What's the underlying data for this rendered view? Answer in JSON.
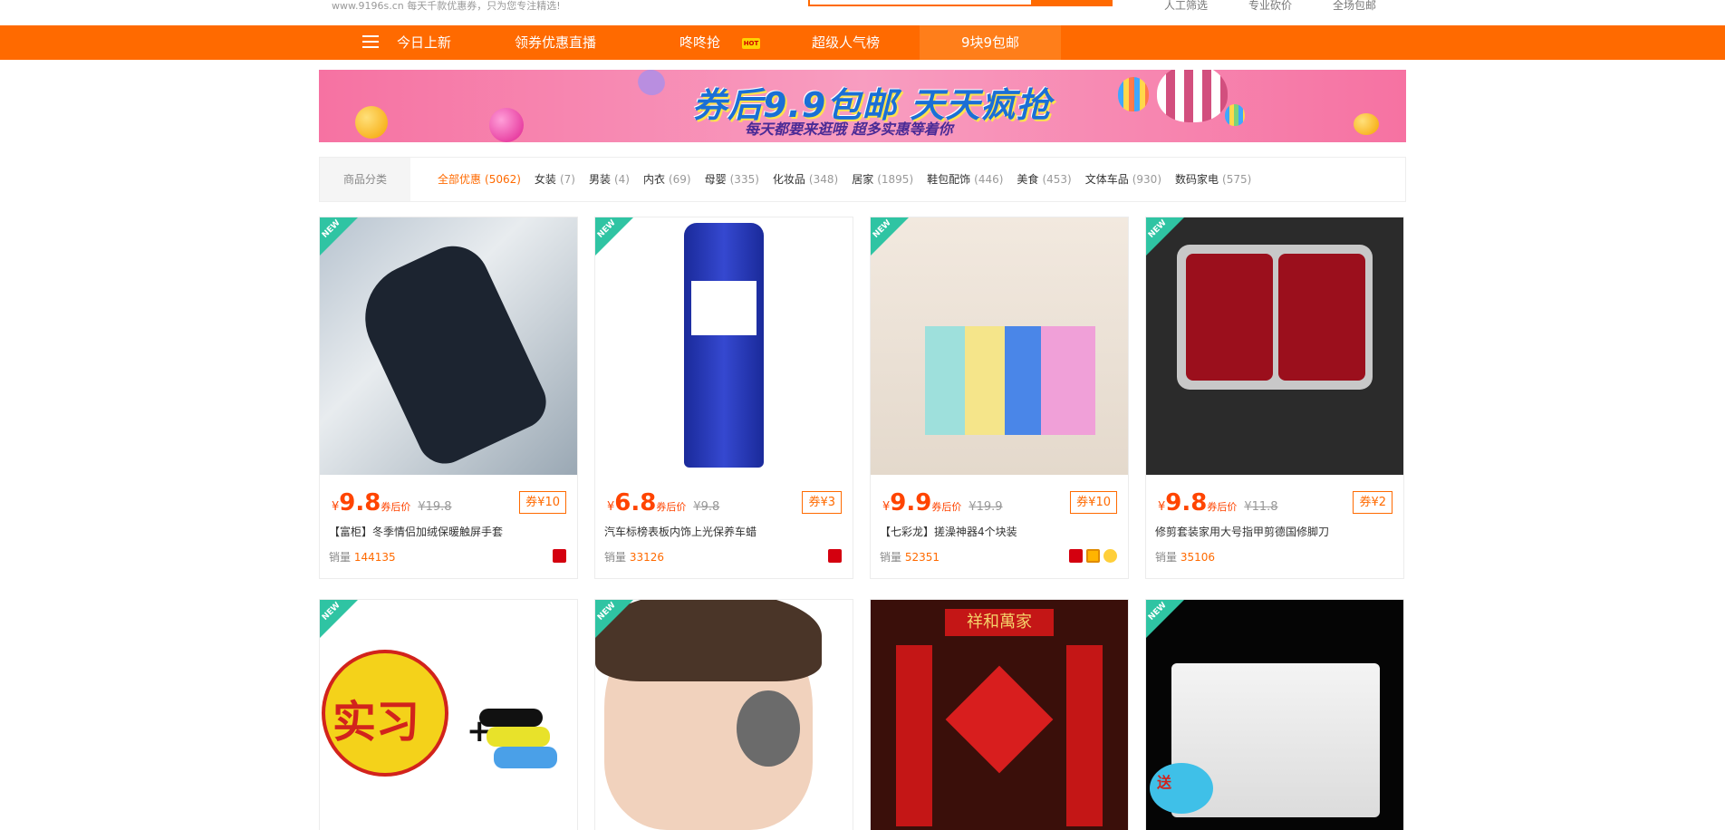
{
  "header": {
    "slogan": "www.9196s.cn  每天千款优惠券，只为您专注精选!",
    "links": [
      "人工筛选",
      "专业砍价",
      "全场包邮"
    ]
  },
  "nav": {
    "items": [
      "今日上新",
      "领券优惠直播",
      "咚咚抢",
      "超级人气榜",
      "9块9包邮"
    ],
    "hot": "HOT"
  },
  "banner": {
    "title": "券后9.9包邮 天天疯抢",
    "subtitle": "每天都要来逛哦  超多实惠等着你"
  },
  "categories": {
    "label": "商品分类",
    "items": [
      {
        "name": "全部优惠",
        "count": "(5062)"
      },
      {
        "name": "女装",
        "count": "(7)"
      },
      {
        "name": "男装",
        "count": "(4)"
      },
      {
        "name": "内衣",
        "count": "(69)"
      },
      {
        "name": "母婴",
        "count": "(335)"
      },
      {
        "name": "化妆品",
        "count": "(348)"
      },
      {
        "name": "居家",
        "count": "(1895)"
      },
      {
        "name": "鞋包配饰",
        "count": "(446)"
      },
      {
        "name": "美食",
        "count": "(453)"
      },
      {
        "name": "文体车品",
        "count": "(930)"
      },
      {
        "name": "数码家电",
        "count": "(575)"
      }
    ]
  },
  "products": [
    {
      "yen": "¥",
      "price": "9.8",
      "after": "券后价",
      "orig": "¥19.8",
      "coupon": "券¥10",
      "title": "【富柜】冬季情侣加绒保暖触屏手套",
      "sales_label": "销量",
      "sales": "144135",
      "new": "NEW"
    },
    {
      "yen": "¥",
      "price": "6.8",
      "after": "券后价",
      "orig": "¥9.8",
      "coupon": "券¥3",
      "title": "汽车标榜表板内饰上光保养车蜡",
      "sales_label": "销量",
      "sales": "33126",
      "new": "NEW"
    },
    {
      "yen": "¥",
      "price": "9.9",
      "after": "券后价",
      "orig": "¥19.9",
      "coupon": "券¥10",
      "title": "【七彩龙】搓澡神器4个块装",
      "sales_label": "销量",
      "sales": "52351",
      "new": "NEW"
    },
    {
      "yen": "¥",
      "price": "9.8",
      "after": "券后价",
      "orig": "¥11.8",
      "coupon": "券¥2",
      "title": "修剪套装家用大号指甲剪德国修脚刀",
      "sales_label": "销量",
      "sales": "35106",
      "new": "NEW"
    },
    {
      "new": "NEW",
      "img_text": "实习"
    },
    {
      "new": "NEW"
    },
    {
      "img_text": "祥和萬家"
    },
    {
      "new": "NEW",
      "img_text": "送"
    }
  ]
}
